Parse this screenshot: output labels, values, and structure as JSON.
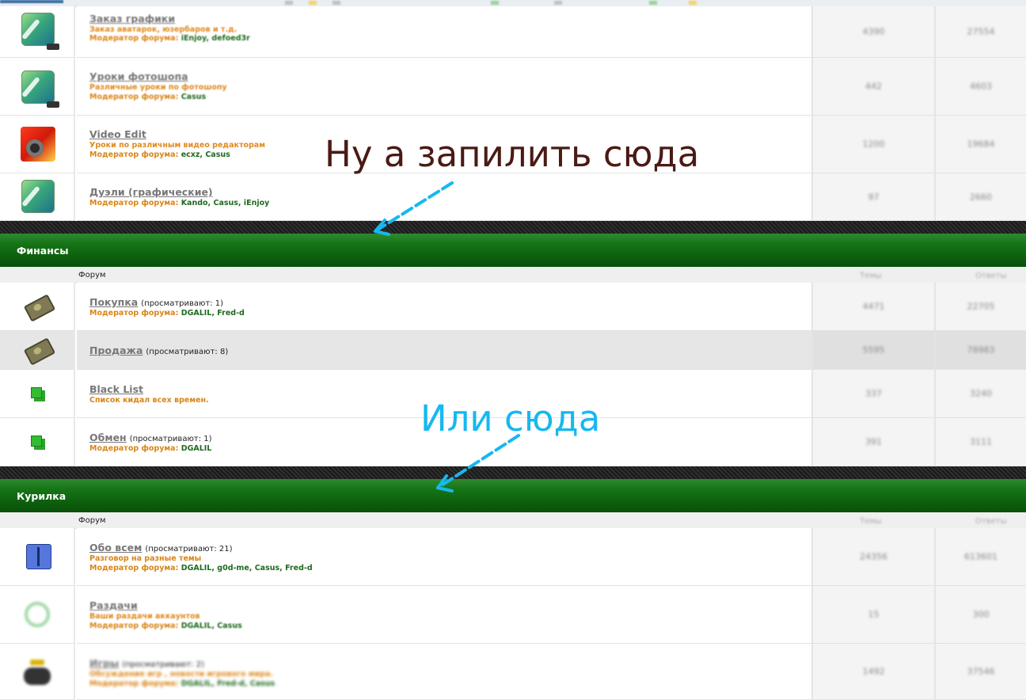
{
  "colors": {
    "category_bar": "#0d5f0d",
    "link_title": "#777777",
    "description": "#e08a1e",
    "moderator_names": "#1f6a1f",
    "annotation_dark": "#4a1a14",
    "annotation_blue": "#16b8f0"
  },
  "top_forums": [
    {
      "title": "Заказ графики",
      "description": "Заказ аватарок, юзербаров и т.д.",
      "moderator_label": "Модератор форума:",
      "moderators": "iEnjoy, defoed3r",
      "topics": "4390",
      "posts": "27554",
      "icon": "feather-icon"
    },
    {
      "title": "Уроки фотошопа",
      "description": "Различные уроки по фотошопу",
      "moderator_label": "Модератор форума:",
      "moderators": "Casus",
      "topics": "442",
      "posts": "4603",
      "icon": "feather-icon"
    },
    {
      "title": "Video Edit",
      "description": "Уроки по различным видео редакторам",
      "moderator_label": "Модератор форума:",
      "moderators": "ecxz, Casus",
      "topics": "1200",
      "posts": "19684",
      "icon": "film-icon"
    },
    {
      "title": "Дуэли (графические)",
      "moderator_label": "Модератор форума:",
      "moderators": "Kando, Casus, iEnjoy",
      "topics": "97",
      "posts": "2660",
      "icon": "feather-icon"
    }
  ],
  "categories": {
    "finance": {
      "title": "Финансы",
      "col_forum": "Форум",
      "col_topics": "Темы",
      "col_posts": "Ответы",
      "forums": [
        {
          "title": "Покупка",
          "viewers": "(просматривают: 1)",
          "moderator_label": "Модератор форума:",
          "moderators": "DGALIL, Fred-d",
          "topics": "4471",
          "posts": "22705",
          "icon": "money-icon"
        },
        {
          "title": "Продажа",
          "viewers": "(просматривают: 8)",
          "topics": "5595",
          "posts": "78983",
          "icon": "money-icon"
        },
        {
          "title": "Black List",
          "description": "Список кидал всех времен.",
          "topics": "337",
          "posts": "3240",
          "icon": "green-squares-icon"
        },
        {
          "title": "Обмен",
          "viewers": "(просматривают: 1)",
          "moderator_label": "Модератор форума:",
          "moderators": "DGALIL",
          "topics": "391",
          "posts": "3111",
          "icon": "green-squares-icon"
        }
      ]
    },
    "smoking": {
      "title": "Курилка",
      "col_forum": "Форум",
      "col_topics": "Темы",
      "col_posts": "Ответы",
      "forums": [
        {
          "title": "Обо всем",
          "viewers": "(просматривают: 21)",
          "description": "Разговор на разные темы",
          "moderator_label": "Модератор форума:",
          "moderators": "DGALIL, g0d-me, Casus, Fred-d",
          "topics": "24356",
          "posts": "613601",
          "icon": "finder-icon"
        },
        {
          "title": "Раздачи",
          "description": "Ваши раздачи аккаунтов",
          "moderator_label": "Модератор форума:",
          "moderators": "DGALIL, Casus",
          "topics": "15",
          "posts": "300",
          "icon": "recycle-icon"
        },
        {
          "title": "Игры",
          "viewers": "(просматривают: 2)",
          "description": "Обсуждение игр , новости игрового мира.",
          "moderator_label": "Модератор форума:",
          "moderators": "DGALIL, Fred-d, Casus",
          "topics": "1492",
          "posts": "37546",
          "icon": "gamepad-icon"
        }
      ]
    }
  },
  "annotations": {
    "first": "Ну а запилить сюда",
    "second": "Или сюда"
  }
}
